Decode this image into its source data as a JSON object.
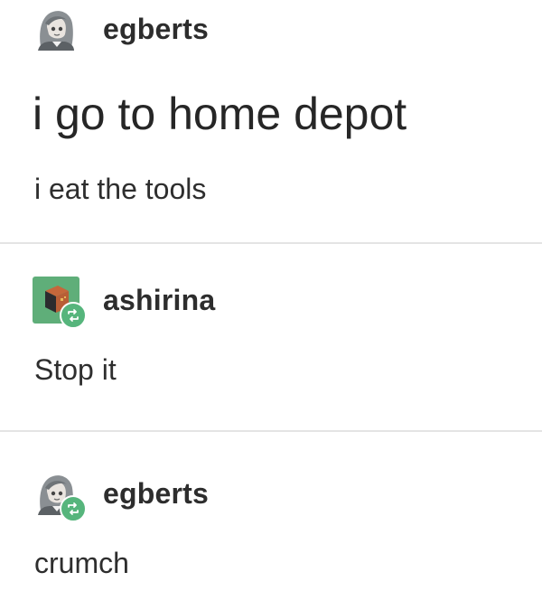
{
  "posts": [
    {
      "username": "egberts",
      "avatar_icon": "anime-girl-avatar-icon",
      "reblog": false,
      "title": "i go to home depot",
      "body": "i eat the tools"
    },
    {
      "username": "ashirina",
      "avatar_icon": "cube-avatar-icon",
      "reblog": true,
      "reblog_icon": "reblog-icon",
      "body": "Stop it"
    },
    {
      "username": "egberts",
      "avatar_icon": "anime-girl-avatar-icon",
      "reblog": true,
      "reblog_icon": "reblog-icon",
      "body": "crumch"
    }
  ],
  "colors": {
    "reblog_badge": "#56b57c",
    "divider": "#e4e4e4",
    "cube_avatar_bg": "#5fae79"
  }
}
